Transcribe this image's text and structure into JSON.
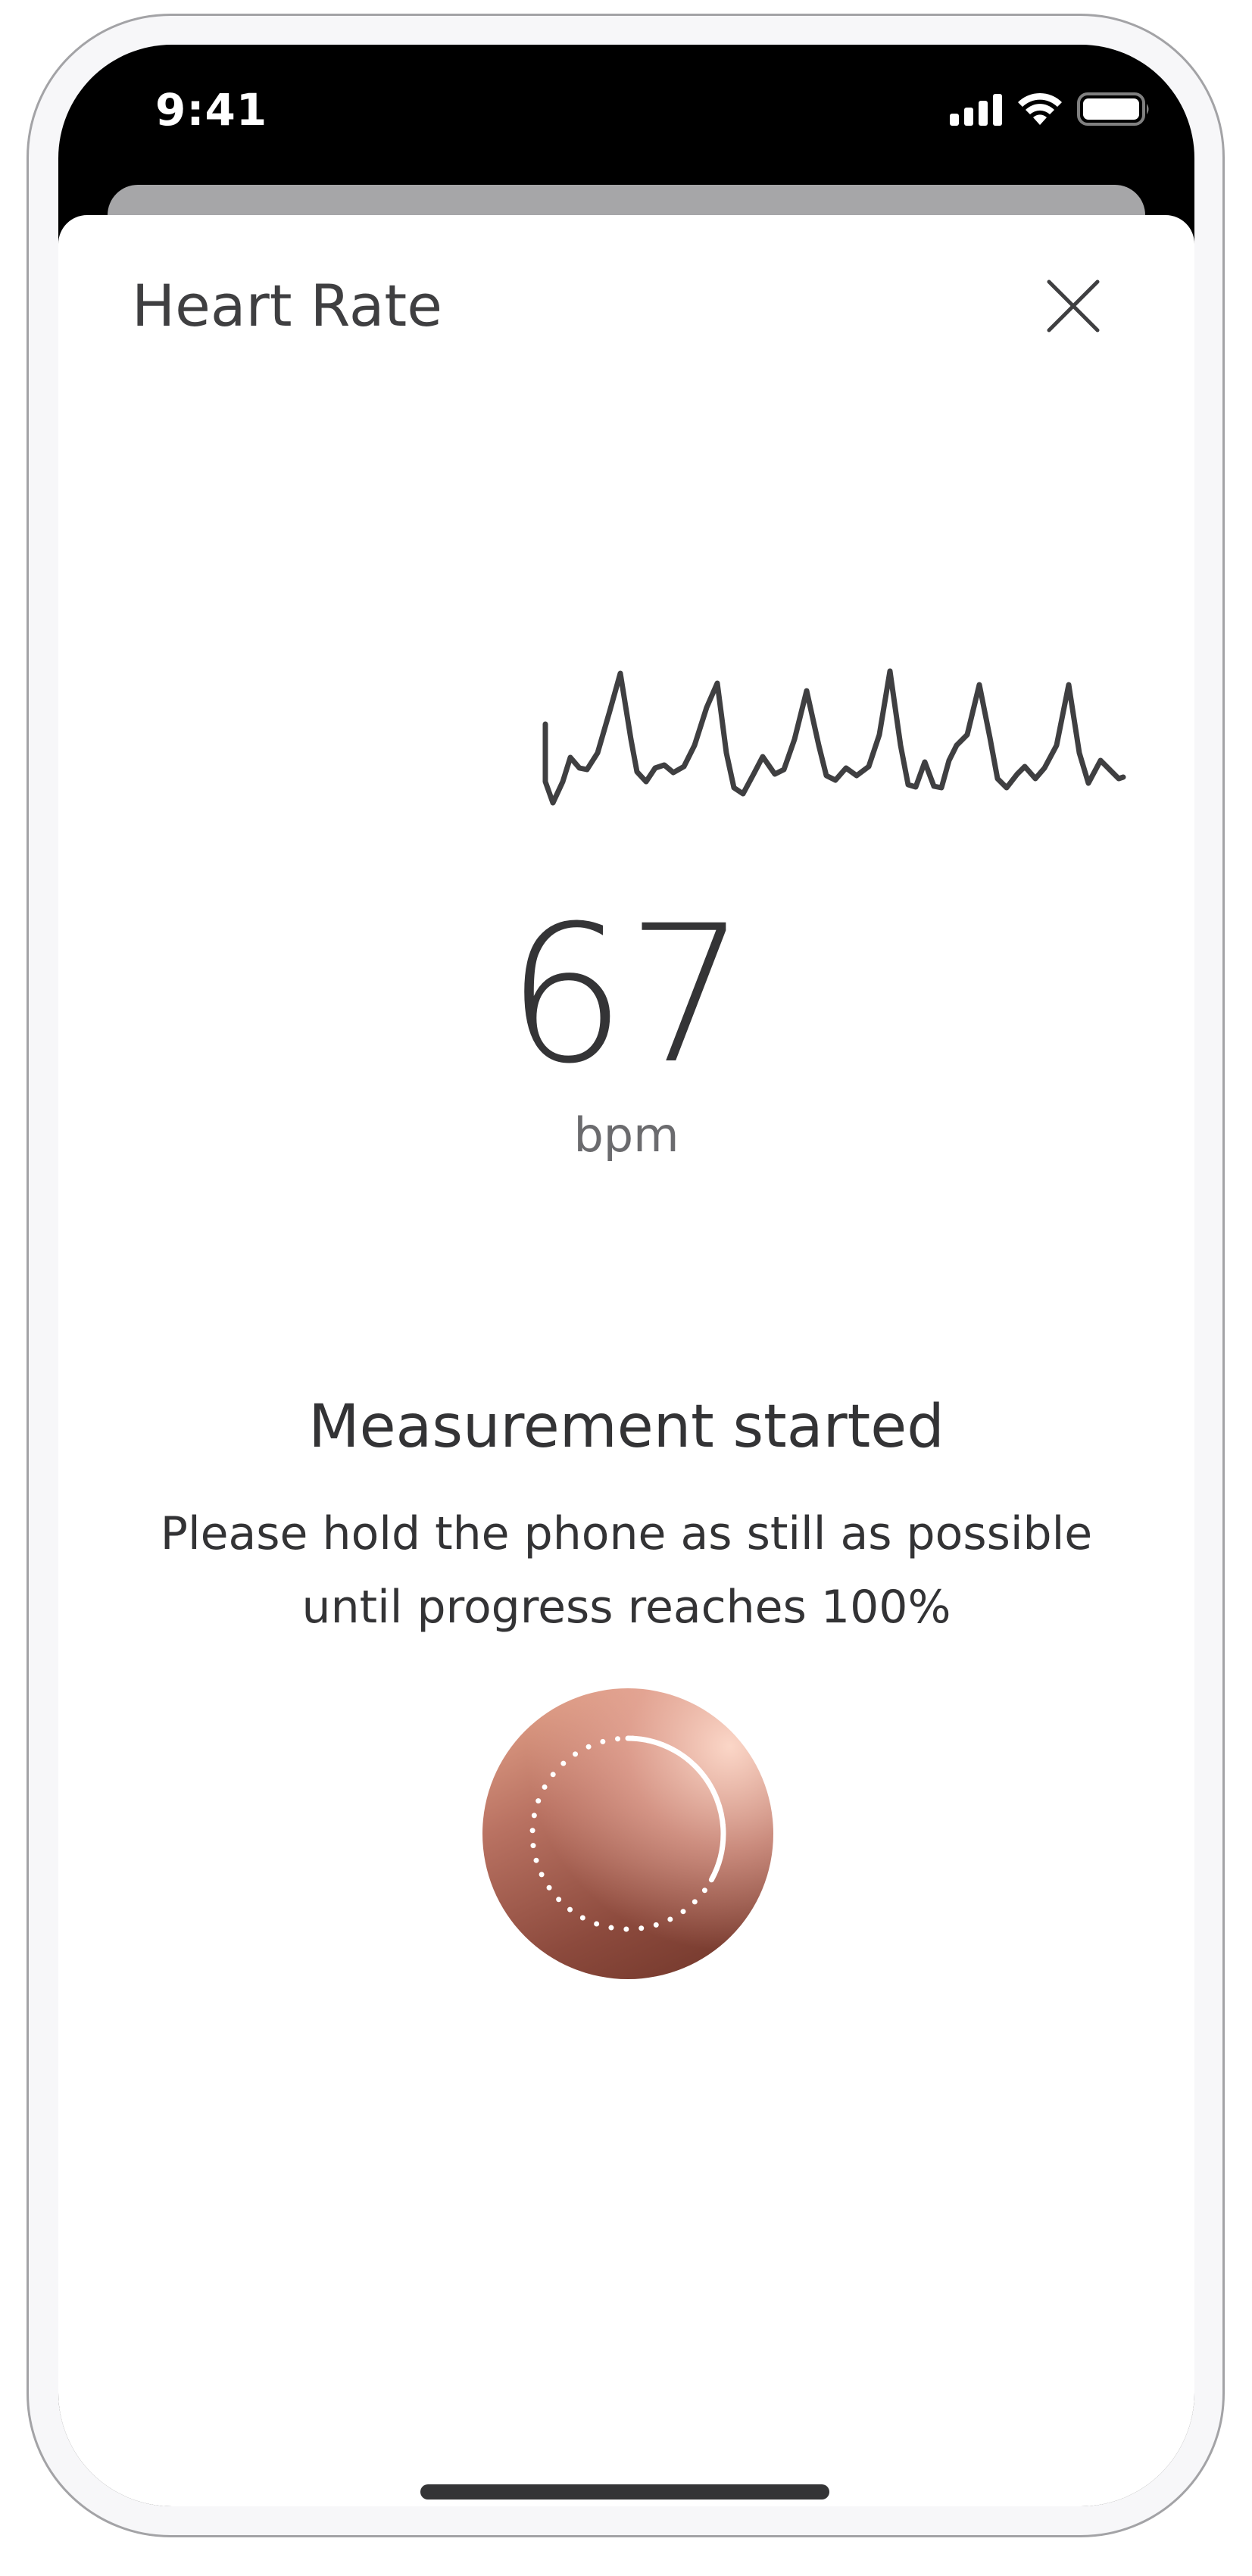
{
  "status_bar": {
    "time": "9:41",
    "signal_icon": "cellular-signal-icon",
    "wifi_icon": "wifi-icon",
    "battery_icon": "battery-icon"
  },
  "header": {
    "title": "Heart Rate",
    "close_icon": "close-icon"
  },
  "measurement": {
    "value": "67",
    "unit": "bpm"
  },
  "message": {
    "title": "Measurement started",
    "body_line1": "Please hold the phone as still as possible",
    "body_line2": "until progress reaches 100%"
  },
  "progress": {
    "icon": "progress-ring-icon",
    "fraction": 0.33
  },
  "colors": {
    "text_primary": "#333335",
    "text_secondary": "#6b6b6e",
    "waveform": "#3f3f41",
    "orb_dark": "#6e3428",
    "orb_light": "#e9a98f"
  }
}
